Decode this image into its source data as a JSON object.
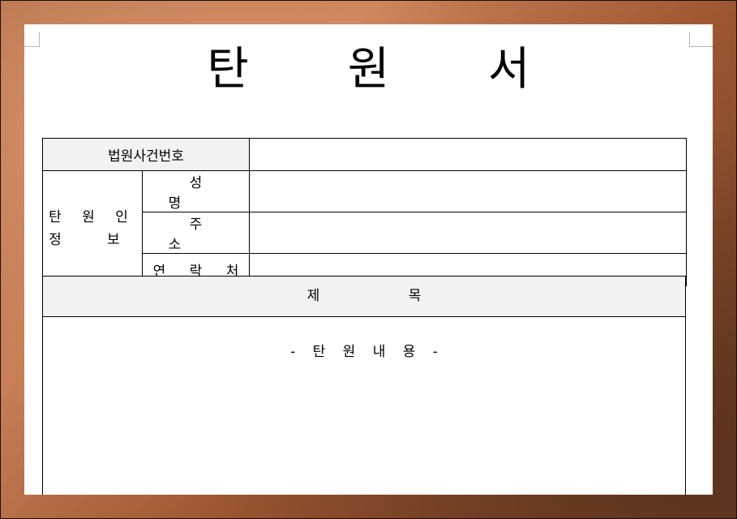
{
  "document": {
    "title": "탄 원 서",
    "case_number_label": "법원사건번호",
    "case_number_value": "",
    "petitioner_info_label_line1": "탄 원 인",
    "petitioner_info_label_line2": "정   보",
    "name_label": "성 명",
    "name_value": "",
    "address_label": "주 소",
    "address_value": "",
    "contact_label": "연 락 처",
    "contact_value": "",
    "subject_label": "제 목",
    "content_placeholder": "- 탄 원 내 용 -"
  },
  "colors": {
    "frame_background": "#a35e37",
    "page_background": "#ffffff",
    "header_cell_shade": "#f2f2f2"
  }
}
